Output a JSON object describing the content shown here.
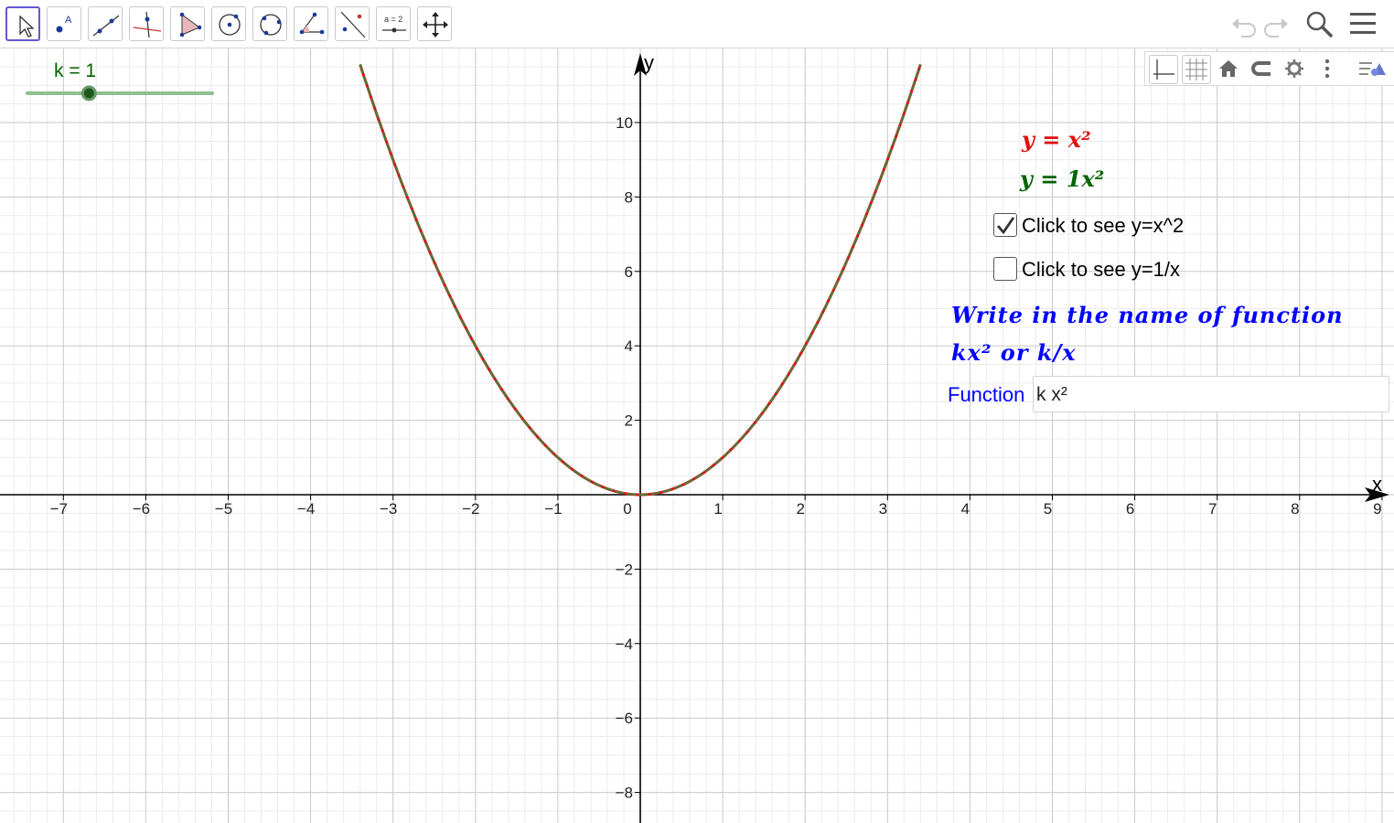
{
  "toolbar": {
    "tools": [
      {
        "name": "move-tool"
      },
      {
        "name": "point-tool",
        "label": "A"
      },
      {
        "name": "line-tool"
      },
      {
        "name": "perpendicular-line-tool"
      },
      {
        "name": "polygon-tool"
      },
      {
        "name": "circle-center-point-tool"
      },
      {
        "name": "circle-three-points-tool"
      },
      {
        "name": "angle-tool"
      },
      {
        "name": "reflect-tool"
      },
      {
        "name": "slider-tool",
        "label": "a = 2"
      },
      {
        "name": "move-graphics-view-tool"
      }
    ],
    "right_icons": [
      "undo-icon",
      "redo-icon",
      "search-icon",
      "menu-icon"
    ]
  },
  "style_bar": [
    "show-axes-icon",
    "show-grid-icon",
    "home-icon",
    "point-capturing-icon",
    "settings-icon",
    "more-options-icon",
    "style-bar-toggle-icon"
  ],
  "slider": {
    "label": "k = 1",
    "value": 1,
    "min": -1,
    "max": 5
  },
  "equations": {
    "eq1": "y = x²",
    "eq2": "y = 1x²",
    "eq1_color": "#e01010",
    "eq2_color": "#006400"
  },
  "checkboxes": [
    {
      "label": "Click to see y=x^2",
      "checked": true
    },
    {
      "label": "Click to see y=1/x",
      "checked": false
    }
  ],
  "instruction": {
    "line1": "Write in the name of function",
    "line2": "kx² or k/x",
    "color": "#0000ff"
  },
  "input": {
    "label": "Function",
    "value": "k x²"
  },
  "chart_data": {
    "type": "line",
    "xlabel": "x",
    "ylabel": "y",
    "xlim": [
      -7.7,
      9.2
    ],
    "ylim": [
      -8.6,
      11.6
    ],
    "grid": true,
    "x_ticks": [
      "−7",
      "−6",
      "−5",
      "−4",
      "−3",
      "−2",
      "−1",
      "0",
      "1",
      "2",
      "3",
      "4",
      "5",
      "6",
      "7",
      "8",
      "9"
    ],
    "y_ticks": [
      "10",
      "8",
      "6",
      "4",
      "2",
      "−2",
      "−4",
      "−6",
      "−8"
    ],
    "series": [
      {
        "function": "y = x^2",
        "color": "#e01010",
        "x": [
          -3.4,
          -3,
          -2.5,
          -2,
          -1.5,
          -1,
          -0.5,
          0,
          0.5,
          1,
          1.5,
          2,
          2.5,
          3,
          3.4
        ],
        "y": [
          11.56,
          9,
          6.25,
          4,
          2.25,
          1,
          0.25,
          0,
          0.25,
          1,
          2.25,
          4,
          6.25,
          9,
          11.56
        ]
      },
      {
        "function": "y = 1x^2",
        "color": "#4a7a3a",
        "x": [
          -3.4,
          -3,
          -2.5,
          -2,
          -1.5,
          -1,
          -0.5,
          0,
          0.5,
          1,
          1.5,
          2,
          2.5,
          3,
          3.4
        ],
        "y": [
          11.56,
          9,
          6.25,
          4,
          2.25,
          1,
          0.25,
          0,
          0.25,
          1,
          2.25,
          4,
          6.25,
          9,
          11.56
        ]
      }
    ]
  }
}
